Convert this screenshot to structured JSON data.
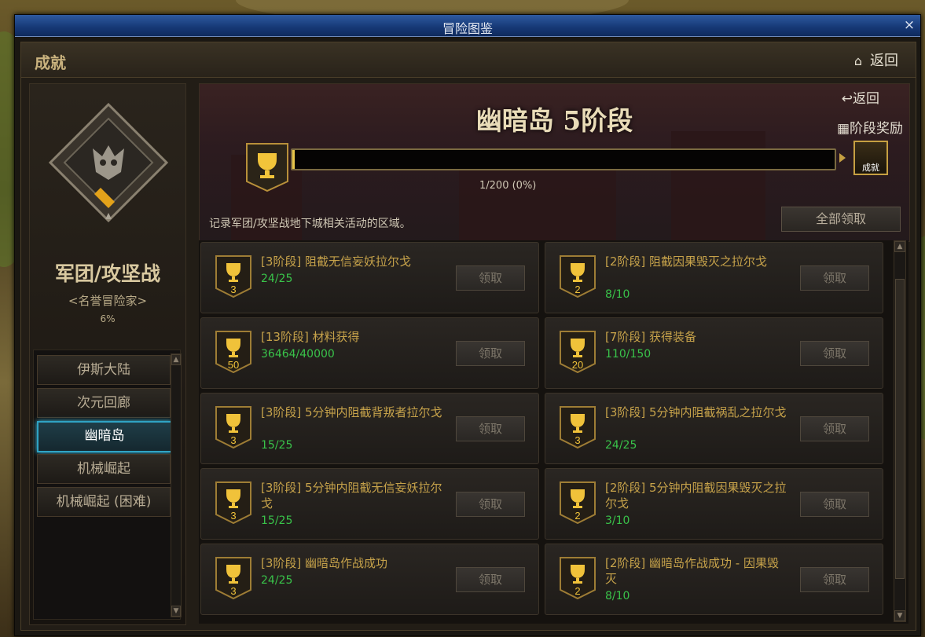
{
  "window": {
    "title": "冒险图鉴",
    "close_glyph": "×"
  },
  "header": {
    "section_title": "成就",
    "back_label": "返回"
  },
  "dungeon": {
    "name": "军团/攻坚战",
    "title": "<名誉冒险家>",
    "percent": "6%"
  },
  "regions": [
    {
      "label": "伊斯大陆",
      "active": false
    },
    {
      "label": "次元回廊",
      "active": false
    },
    {
      "label": "幽暗岛",
      "active": true
    },
    {
      "label": "机械崛起",
      "active": false
    },
    {
      "label": "机械崛起 (困难)",
      "active": false
    }
  ],
  "banner": {
    "stage_title": "幽暗岛 5阶段",
    "back_label": "↩返回",
    "reward_label": "阶段奖励",
    "chest_text": "成就",
    "progress_text": "1/200 (0%)",
    "progress_fraction": 0.005,
    "description": "记录军团/攻坚战地下城相关活动的区域。",
    "claim_all": "全部领取"
  },
  "achievements": [
    {
      "name": "[3阶段] 阻截无信妄妖拉尔戈",
      "progress": "24/25",
      "level": "3",
      "button": "领取"
    },
    {
      "name": "[2阶段] 阻截因果毁灭之拉尔戈",
      "progress": "8/10",
      "level": "2",
      "button": "领取"
    },
    {
      "name": "[13阶段] 材料获得",
      "progress": "36464/40000",
      "level": "50",
      "button": "领取"
    },
    {
      "name": "[7阶段] 获得装备",
      "progress": "110/150",
      "level": "20",
      "button": "领取"
    },
    {
      "name": "[3阶段] 5分钟内阻截背叛者拉尔戈",
      "progress": "15/25",
      "level": "3",
      "button": "领取"
    },
    {
      "name": "[3阶段] 5分钟内阻截祸乱之拉尔戈",
      "progress": "24/25",
      "level": "3",
      "button": "领取"
    },
    {
      "name": "[3阶段] 5分钟内阻截无信妄妖拉尔戈",
      "progress": "15/25",
      "level": "3",
      "button": "领取"
    },
    {
      "name": "[2阶段] 5分钟内阻截因果毁灭之拉尔戈",
      "progress": "3/10",
      "level": "2",
      "button": "领取"
    },
    {
      "name": "[3阶段] 幽暗岛作战成功",
      "progress": "24/25",
      "level": "3",
      "button": "领取"
    },
    {
      "name": "[2阶段] 幽暗岛作战成功 - 因果毁灭",
      "progress": "8/10",
      "level": "2",
      "button": "领取"
    }
  ],
  "colors": {
    "gold": "#c6a24a",
    "progress_green": "#39c34a",
    "active_region": "#2fa3c4",
    "title_bar": "#173a78"
  }
}
